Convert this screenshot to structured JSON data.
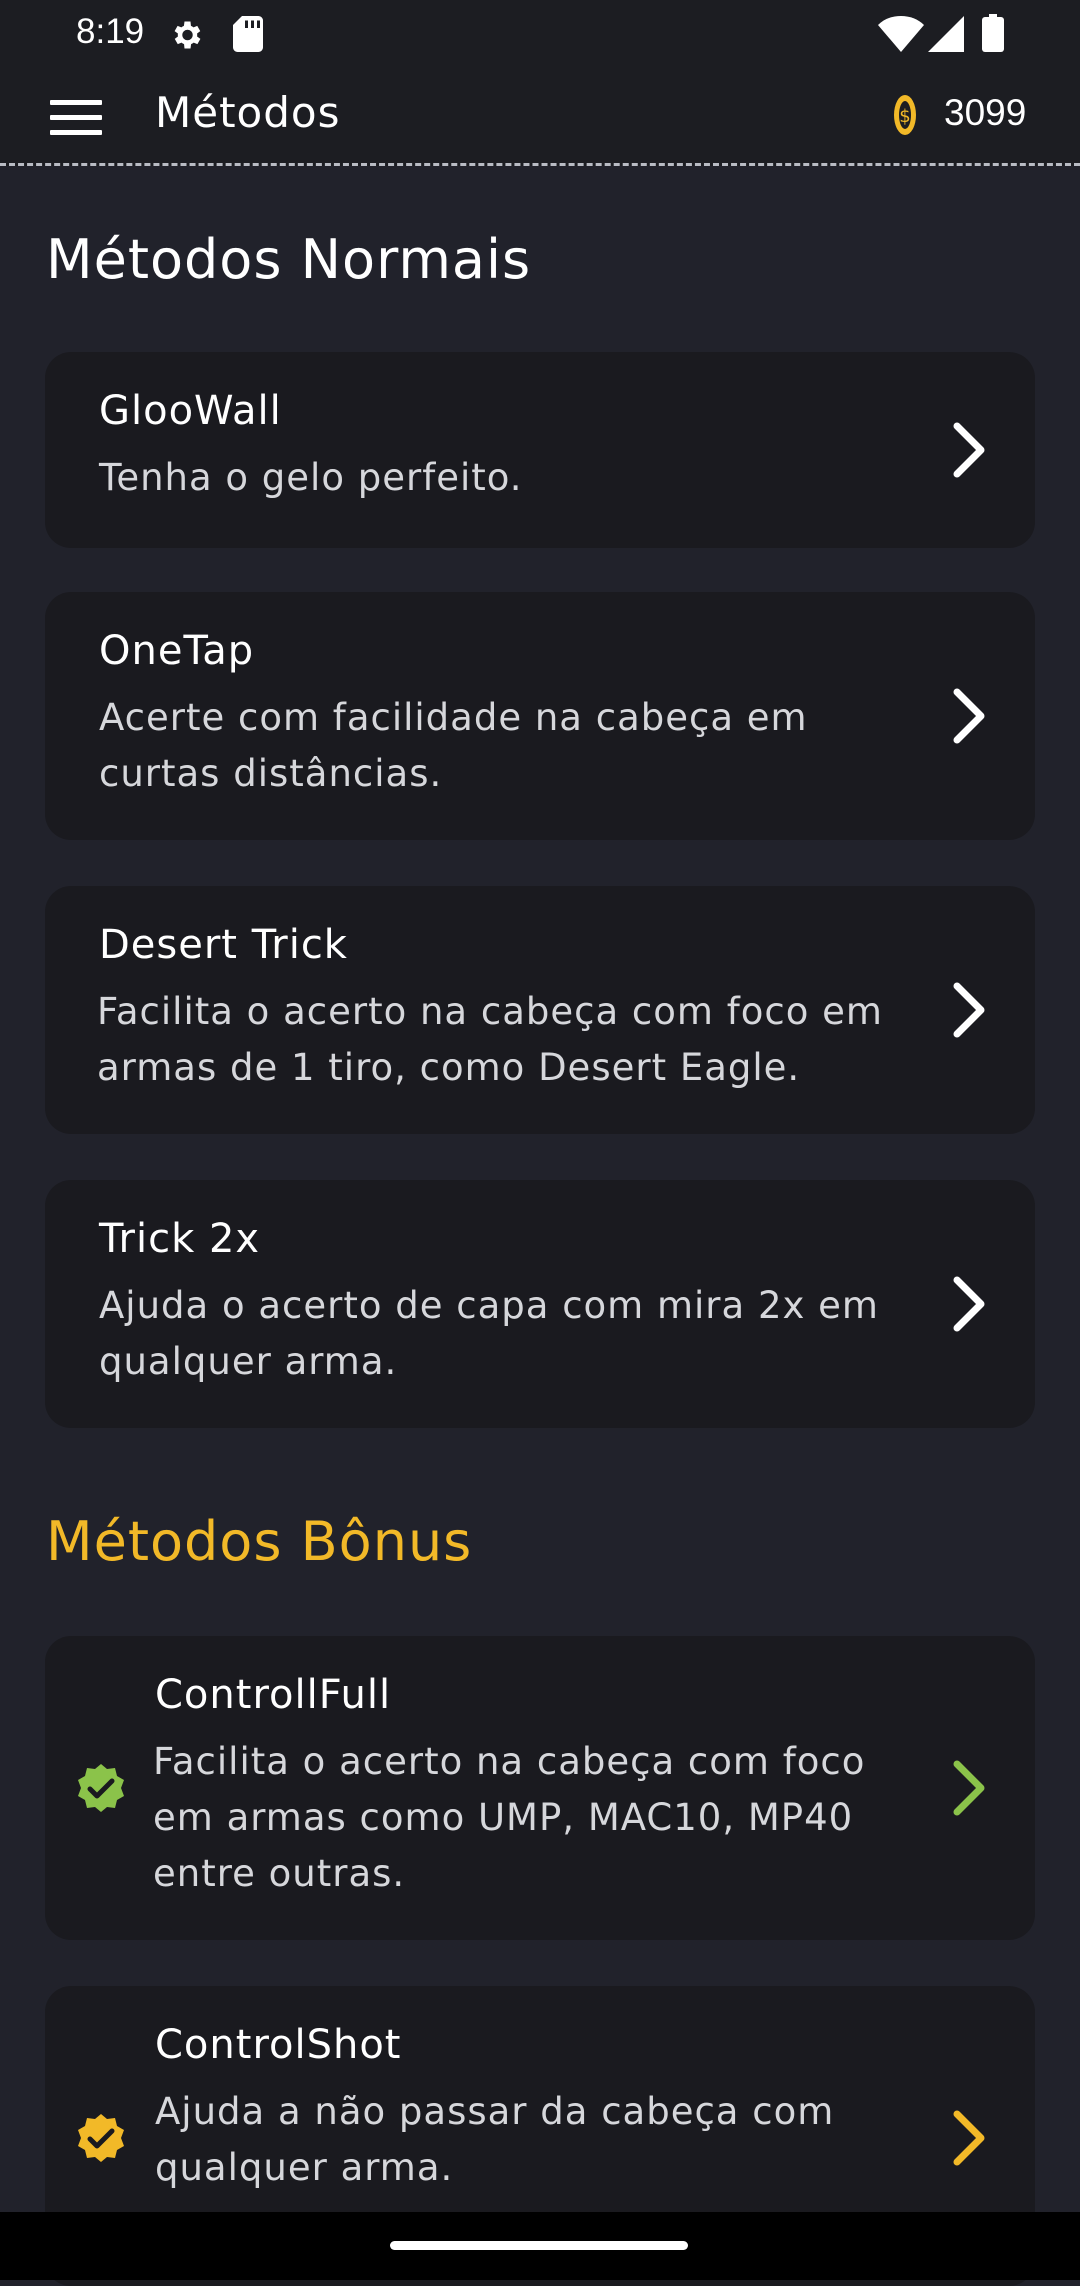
{
  "status_bar": {
    "time": "8:19",
    "icons": [
      "gear-icon",
      "sd-card-icon",
      "wifi-icon",
      "signal-icon",
      "battery-icon"
    ]
  },
  "app_bar": {
    "title": "Métodos",
    "coins": "3099",
    "menu_icon": "menu-icon",
    "coin_icon": "coin-icon"
  },
  "sections": {
    "normal": {
      "title": "Métodos Normais",
      "items": [
        {
          "title": "GlooWall",
          "desc": "Tenha o gelo perfeito."
        },
        {
          "title": "OneTap",
          "desc": "Acerte com facilidade na cabeça em curtas distâncias."
        },
        {
          "title": "Desert Trick",
          "desc": "Facilita o acerto na cabeça com foco em armas de 1 tiro, como Desert Eagle."
        },
        {
          "title": "Trick 2x",
          "desc": "Ajuda o acerto de capa com mira 2x em qualquer arma."
        }
      ]
    },
    "bonus": {
      "title": "Métodos Bônus",
      "items": [
        {
          "title": "ControllFull",
          "desc": "Facilita o acerto na cabeça com foco em armas como UMP, MAC10, MP40 entre outras.",
          "color": "#8bc34a"
        },
        {
          "title": "ControlShot",
          "desc": "Ajuda a não passar da cabeça com qualquer arma.",
          "color": "#f2b928"
        }
      ]
    }
  },
  "colors": {
    "background": "#21222b",
    "card": "#1a1a1f",
    "accent_yellow": "#f2b928",
    "accent_green": "#8bc34a"
  }
}
